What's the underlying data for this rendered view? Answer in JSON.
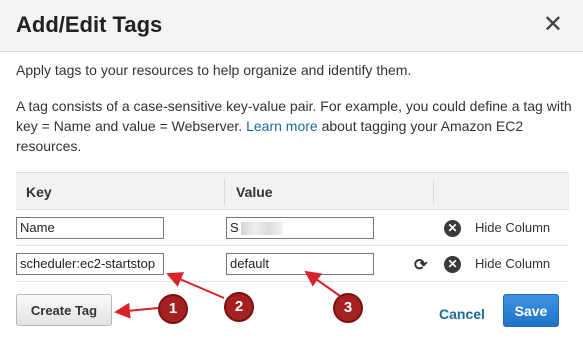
{
  "dialog": {
    "title": "Add/Edit Tags",
    "close_glyph": "✕",
    "intro": "Apply tags to your resources to help organize and identify them.",
    "desc_before": "A tag consists of a case-sensitive key-value pair. For example, you could define a tag with key = Name and value = Webserver.",
    "learn_more": "Learn more",
    "desc_after": "about tagging your Amazon EC2 resources."
  },
  "table": {
    "key_header": "Key",
    "value_header": "Value",
    "rows": [
      {
        "key": "Name",
        "value": "S",
        "action": "Hide Column",
        "has_refresh": false
      },
      {
        "key": "scheduler:ec2-startstop",
        "value": "default",
        "action": "Hide Column",
        "has_refresh": true
      }
    ]
  },
  "buttons": {
    "create_tag": "Create Tag",
    "cancel": "Cancel",
    "save": "Save"
  },
  "annotations": {
    "callouts": [
      "1",
      "2",
      "3"
    ],
    "arrow_color": "#d9232a",
    "callout_color": "#a52020"
  },
  "icons": {
    "close": "close-icon",
    "refresh": "refresh-icon",
    "remove": "x-circle-icon"
  }
}
